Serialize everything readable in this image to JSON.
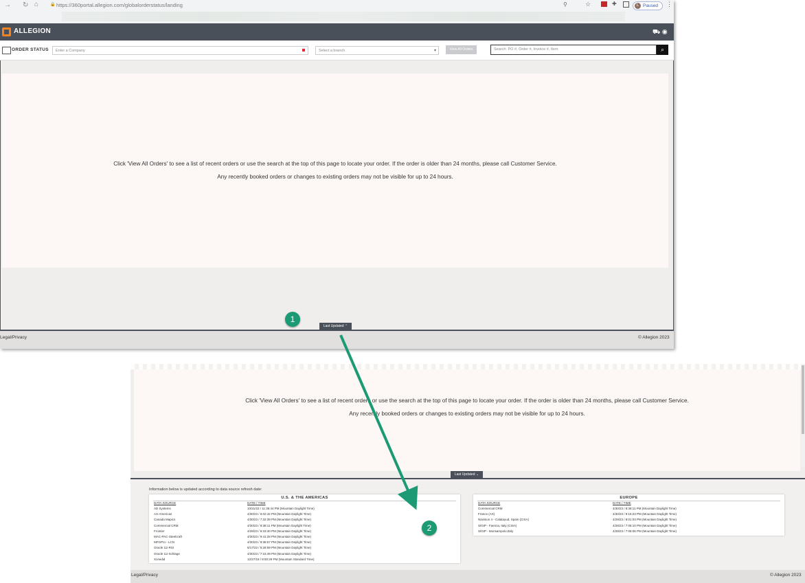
{
  "browser": {
    "url": "https://360portal.allegion.com/globalorderstatus/landing",
    "profile_initial": "L",
    "profile_status": "Paused"
  },
  "app": {
    "brand": "ALLEGION",
    "brand_color": "#f58220",
    "header_color": "#4a5059"
  },
  "filters": {
    "module_label": "ORDER STATUS",
    "company_placeholder": "Enter a Company",
    "branch_placeholder": "Select a branch",
    "view_all_label": "View All Orders",
    "search_placeholder": "Search: PO #, Order #, Invoice #, Item"
  },
  "landing": {
    "line1": "Click 'View All Orders' to see a list of recent orders or use the search at the top of this page to locate your order. If the order is older than 24 months, please call Customer Service.",
    "line2": "Any recently booked orders or changes to existing orders may not be visible for up to 24 hours."
  },
  "last_updated": {
    "label": "Last Updated",
    "note": "Information below is updated according to data source refresh date:",
    "col_source": "DATA SOURCE",
    "col_time": "DATE / TIME",
    "regions": [
      {
        "title": "U.S. & THE AMERICAS",
        "rows": [
          {
            "source": "AD Systems",
            "time": "10/31/22 / 11:35:44 PM (Mountain Daylight Time)"
          },
          {
            "source": "AX-Americas",
            "time": "4/30/23 / 6:02:42 PM (Mountain Daylight Time)"
          },
          {
            "source": "Canada Mapics",
            "time": "4/30/23 / 7:32:39 PM (Mountain Daylight Time)"
          },
          {
            "source": "Commercial CRM",
            "time": "4/30/23 / 8:38:11 PM (Mountain Daylight Time)"
          },
          {
            "source": "Frontier",
            "time": "4/28/23 / 6:33:40 PM (Mountain Daylight Time)"
          },
          {
            "source": "MAC-PAC-Steelcraft",
            "time": "4/30/23 / 9:41:28 PM (Mountain Daylight Time)"
          },
          {
            "source": "MFGPro - LCN",
            "time": "4/30/23 / 9:38:57 PM (Mountain Daylight Time)"
          },
          {
            "source": "Oracle 11i-RSI",
            "time": "6/17/22 / 5:28:59 PM (Mountain Daylight Time)"
          },
          {
            "source": "Oracle 11i-Schlage",
            "time": "4/30/23 / 7:15:49 PM (Mountain Daylight Time)"
          },
          {
            "source": "Xceedid",
            "time": "12/27/18 / 8:50:29 PM (Mountain Standard Time)"
          }
        ]
      },
      {
        "title": "EUROPE",
        "rows": [
          {
            "source": "Commercial CRM",
            "time": "4/30/23 / 8:38:11 PM (Mountain Daylight Time)"
          },
          {
            "source": "France (AX)",
            "time": "4/30/23 / 9:15:23 PM (Mountain Daylight Time)"
          },
          {
            "source": "Navision 4 - Calatayud, Spain (CISA)",
            "time": "4/29/23 / 8:01:03 PM (Mountain Daylight Time)"
          },
          {
            "source": "SIGIP - Faenza, Italy (CISA)",
            "time": "4/28/23 / 7:06:10 PM (Mountain Daylight Time)"
          },
          {
            "source": "SIGIP - Monsampolo,Italy",
            "time": "4/28/23 / 7:06:06 PM (Mountain Daylight Time)"
          }
        ]
      }
    ]
  },
  "footer": {
    "legal": "Legal/Privacy",
    "copyright": "© Allegion 2023"
  },
  "annotations": {
    "step1": "1",
    "step2": "2",
    "color": "#1c9a74"
  }
}
